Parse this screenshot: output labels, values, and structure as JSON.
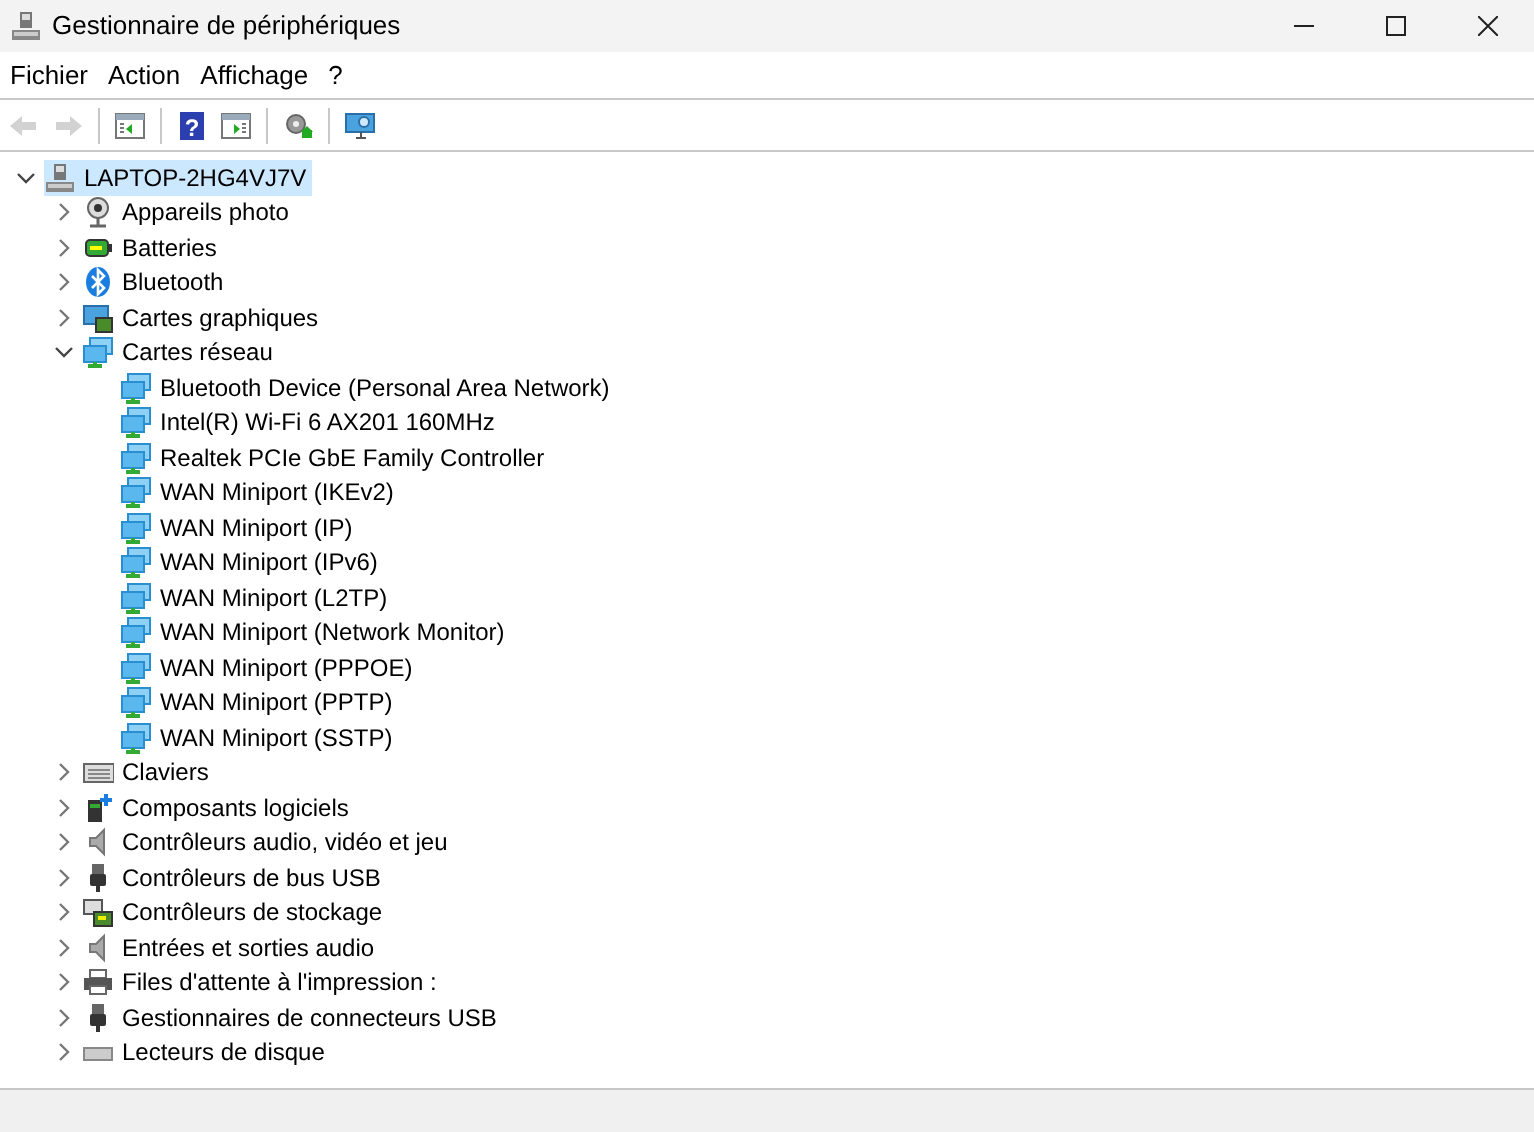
{
  "window": {
    "title": "Gestionnaire de périphériques"
  },
  "menu": [
    "Fichier",
    "Action",
    "Affichage",
    "?"
  ],
  "toolbar": [
    {
      "kind": "back",
      "disabled": true
    },
    {
      "kind": "forward",
      "disabled": true
    },
    {
      "kind": "sep"
    },
    {
      "kind": "console-tree",
      "disabled": false
    },
    {
      "kind": "sep"
    },
    {
      "kind": "help",
      "glyph": "?",
      "disabled": false
    },
    {
      "kind": "properties",
      "disabled": false
    },
    {
      "kind": "sep"
    },
    {
      "kind": "update-driver",
      "disabled": false
    },
    {
      "kind": "sep"
    },
    {
      "kind": "scan",
      "disabled": false
    }
  ],
  "tree": {
    "label": "LAPTOP-2HG4VJ7V",
    "kind": "computer",
    "expanded": true,
    "selected": true,
    "children": [
      {
        "label": "Appareils photo",
        "kind": "camera",
        "expanded": false,
        "selected": false
      },
      {
        "label": "Batteries",
        "kind": "battery",
        "expanded": false,
        "selected": false
      },
      {
        "label": "Bluetooth",
        "kind": "bluetooth",
        "expanded": false,
        "selected": false
      },
      {
        "label": "Cartes graphiques",
        "kind": "display",
        "expanded": false,
        "selected": false
      },
      {
        "label": "Cartes réseau",
        "kind": "network",
        "expanded": true,
        "selected": false,
        "children": [
          {
            "label": "Bluetooth Device (Personal Area Network)",
            "kind": "network",
            "selected": false
          },
          {
            "label": "Intel(R) Wi-Fi 6 AX201 160MHz",
            "kind": "network",
            "selected": false
          },
          {
            "label": "Realtek PCIe GbE Family Controller",
            "kind": "network",
            "selected": false
          },
          {
            "label": "WAN Miniport (IKEv2)",
            "kind": "network",
            "selected": false
          },
          {
            "label": "WAN Miniport (IP)",
            "kind": "network",
            "selected": false
          },
          {
            "label": "WAN Miniport (IPv6)",
            "kind": "network",
            "selected": false
          },
          {
            "label": "WAN Miniport (L2TP)",
            "kind": "network",
            "selected": false
          },
          {
            "label": "WAN Miniport (Network Monitor)",
            "kind": "network",
            "selected": false
          },
          {
            "label": "WAN Miniport (PPPOE)",
            "kind": "network",
            "selected": false
          },
          {
            "label": "WAN Miniport (PPTP)",
            "kind": "network",
            "selected": false
          },
          {
            "label": "WAN Miniport (SSTP)",
            "kind": "network",
            "selected": false
          }
        ]
      },
      {
        "label": "Claviers",
        "kind": "keyboard",
        "expanded": false,
        "selected": false
      },
      {
        "label": "Composants logiciels",
        "kind": "software",
        "expanded": false,
        "selected": false
      },
      {
        "label": "Contrôleurs audio, vidéo et jeu",
        "kind": "speaker",
        "expanded": false,
        "selected": false
      },
      {
        "label": "Contrôleurs de bus USB",
        "kind": "usb",
        "expanded": false,
        "selected": false
      },
      {
        "label": "Contrôleurs de stockage",
        "kind": "storage",
        "expanded": false,
        "selected": false
      },
      {
        "label": "Entrées et sorties audio",
        "kind": "speaker",
        "expanded": false,
        "selected": false
      },
      {
        "label": "Files d'attente à l'impression :",
        "kind": "printer",
        "expanded": false,
        "selected": false
      },
      {
        "label": "Gestionnaires de connecteurs USB",
        "kind": "usb",
        "expanded": false,
        "selected": false
      },
      {
        "label": "Lecteurs de disque",
        "kind": "disk",
        "expanded": false,
        "selected": false
      }
    ]
  }
}
